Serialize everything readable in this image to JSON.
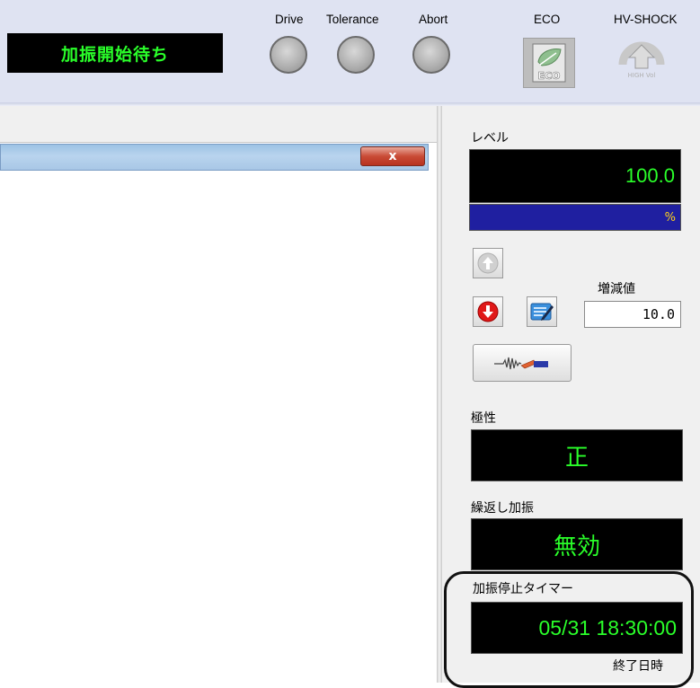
{
  "status": {
    "text": "加振開始待ち"
  },
  "lamps": [
    {
      "label": "Drive"
    },
    {
      "label": "Tolerance"
    },
    {
      "label": "Abort"
    }
  ],
  "eco": {
    "label": "ECO",
    "icon": "eco-leaf-icon"
  },
  "hv_shock": {
    "label": "HV-SHOCK",
    "icon": "high-vol-icon",
    "badge": "HIGH Vol"
  },
  "window": {
    "close_label": "x"
  },
  "level": {
    "label": "レベル",
    "value": "100.0",
    "unit": "%"
  },
  "step": {
    "label": "増減値",
    "value": "10.0"
  },
  "buttons": {
    "up_icon": "up-arrow-icon",
    "down_icon": "down-arrow-icon",
    "edit_icon": "edit-pencil-icon",
    "wave_icon": "waveform-icon"
  },
  "polarity": {
    "label": "極性",
    "value": "正"
  },
  "repeat": {
    "label": "繰返し加振",
    "value": "無効"
  },
  "timer": {
    "label": "加振停止タイマー",
    "value": "05/31 18:30:00",
    "caption": "終了日時"
  },
  "colors": {
    "display_text": "#2aff2a",
    "display_bg": "#000000",
    "level_bar": "#1f1fa0",
    "unit_text": "#ffd21a"
  }
}
